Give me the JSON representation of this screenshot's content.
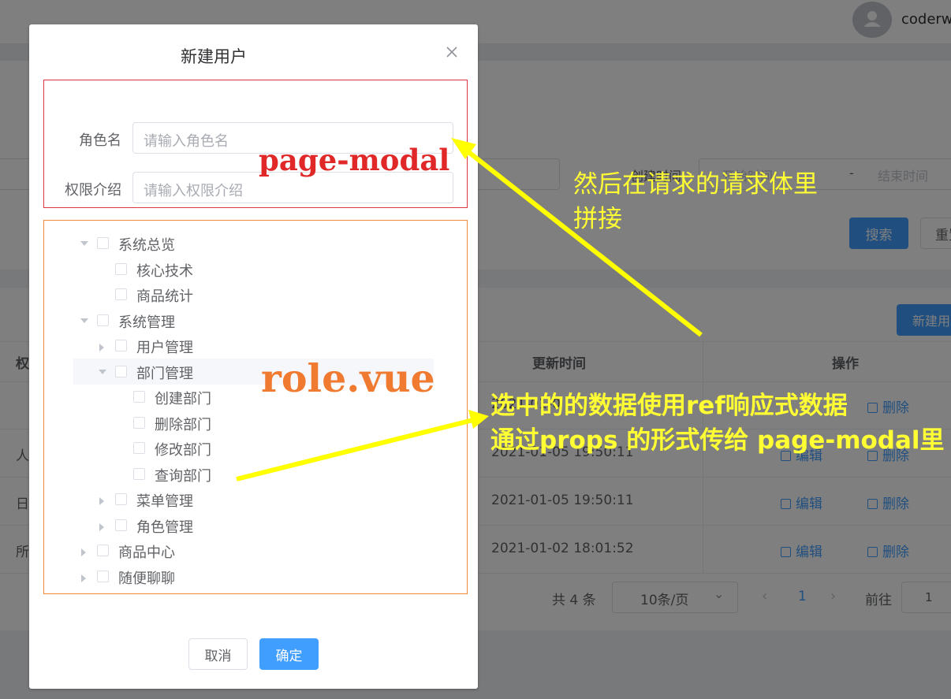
{
  "header": {
    "username": "coderw"
  },
  "search": {
    "create_time_label": "创建时间",
    "start_placeholder": "开始时间",
    "separator": "-",
    "end_placeholder": "结束时间",
    "search_label": "搜索",
    "reset_label": "重置"
  },
  "list": {
    "new_button_label": "新建用户",
    "columns": {
      "first": "权",
      "update_time": "更新时间",
      "actions": "操作"
    },
    "rows": [
      {
        "name": "",
        "update_time": "2021-01-0",
        "edit": "编辑",
        "delete": "删除"
      },
      {
        "name": "人",
        "update_time": "2021-01-05 19:50:11",
        "edit": "编辑",
        "delete": "删除"
      },
      {
        "name": "日",
        "update_time": "2021-01-05 19:50:11",
        "edit": "编辑",
        "delete": "删除"
      },
      {
        "name": "所",
        "update_time": "2021-01-02 18:01:52",
        "edit": "编辑",
        "delete": "删除"
      }
    ]
  },
  "pagination": {
    "total": "共 4 条",
    "page_size": "10条/页",
    "current_page": "1",
    "goto_label": "前往",
    "goto_value": "1"
  },
  "dialog": {
    "title": "新建用户",
    "form": {
      "role_name_label": "角色名",
      "role_name_placeholder": "请输入角色名",
      "intro_label": "权限介绍",
      "intro_placeholder": "请输入权限介绍"
    },
    "tree": [
      {
        "label": "系统总览",
        "level": 0,
        "caret": "down"
      },
      {
        "label": "核心技术",
        "level": 1,
        "caret": "none"
      },
      {
        "label": "商品统计",
        "level": 1,
        "caret": "none"
      },
      {
        "label": "系统管理",
        "level": 0,
        "caret": "down"
      },
      {
        "label": "用户管理",
        "level": 1,
        "caret": "right"
      },
      {
        "label": "部门管理",
        "level": 1,
        "caret": "down",
        "highlighted": true
      },
      {
        "label": "创建部门",
        "level": 2,
        "caret": "none"
      },
      {
        "label": "删除部门",
        "level": 2,
        "caret": "none"
      },
      {
        "label": "修改部门",
        "level": 2,
        "caret": "none"
      },
      {
        "label": "查询部门",
        "level": 2,
        "caret": "none"
      },
      {
        "label": "菜单管理",
        "level": 1,
        "caret": "right"
      },
      {
        "label": "角色管理",
        "level": 1,
        "caret": "right"
      },
      {
        "label": "商品中心",
        "level": 0,
        "caret": "right"
      },
      {
        "label": "随便聊聊",
        "level": 0,
        "caret": "right"
      }
    ],
    "cancel_label": "取消",
    "confirm_label": "确定"
  },
  "annotations": {
    "page_modal": "page-modal",
    "role_vue": "role.vue",
    "note1_line1": "然后在请求的请求体里",
    "note1_line2": "拼接",
    "note2_line1": "选中的的数据使用ref响应式数据",
    "note2_line2": "通过props 的形式传给 page-modal里"
  },
  "colors": {
    "primary": "#409eff",
    "annotation_yellow": "#ffff33",
    "annotation_red": "#e02828",
    "annotation_orange": "#f07a30"
  }
}
